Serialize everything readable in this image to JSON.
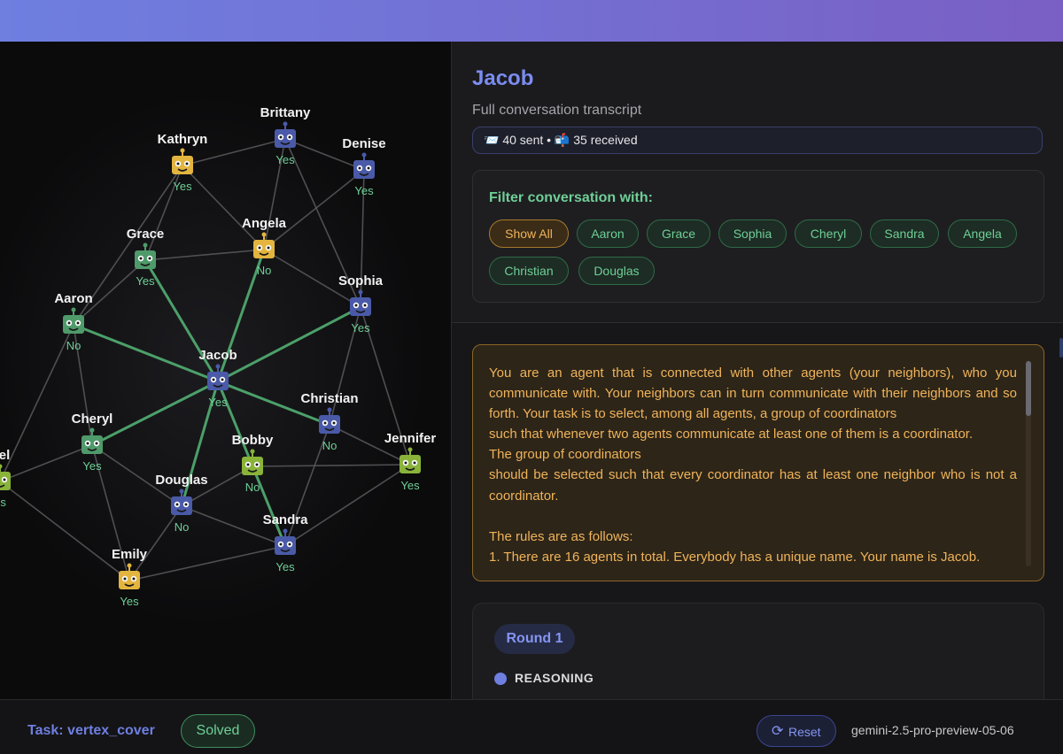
{
  "agent": {
    "name": "Jacob",
    "subtitle": "Full conversation transcript",
    "stats": "📨 40 sent • 📬 35 received"
  },
  "filter": {
    "title": "Filter conversation with:",
    "chips": [
      "Show All",
      "Aaron",
      "Grace",
      "Sophia",
      "Cheryl",
      "Sandra",
      "Angela",
      "Christian",
      "Douglas"
    ],
    "active": "Show All"
  },
  "prompt_text": "You are an agent that is connected with other agents (your neighbors), who you communicate with. Your neighbors can in turn communicate with their neighbors and so forth. Your task is to select, among all agents, a group of coordinators\nsuch that whenever two agents communicate at least one of them is a coordinator.\nThe group of coordinators\nshould be selected such that every coordinator has at least one neighbor who is not a coordinator.\n\nThe rules are as follows:\n1. There are 16 agents in total. Everybody has a unique name. Your name is Jacob.",
  "round": {
    "label": "Round 1",
    "section": "REASONING"
  },
  "footer": {
    "task": "Task: vertex_cover",
    "status": "Solved",
    "reset_label": "Reset",
    "model": "gemini-2.5-pro-preview-05-06"
  },
  "colors": {
    "blue": "#4a5aa8",
    "yellow": "#e3b53f",
    "green": "#4f9a6a",
    "lime": "#8ab33a",
    "edge": "#5a5a5e",
    "highlight": "#4fa86e"
  },
  "graph": {
    "nodes": [
      {
        "id": "Brittany",
        "label": "Brittany",
        "answer": "Yes",
        "color": "blue"
      },
      {
        "id": "Kathryn",
        "label": "Kathryn",
        "answer": "Yes",
        "color": "yellow"
      },
      {
        "id": "Denise",
        "label": "Denise",
        "answer": "Yes",
        "color": "blue"
      },
      {
        "id": "Grace",
        "label": "Grace",
        "answer": "Yes",
        "color": "green"
      },
      {
        "id": "Angela",
        "label": "Angela",
        "answer": "No",
        "color": "yellow"
      },
      {
        "id": "Sophia",
        "label": "Sophia",
        "answer": "Yes",
        "color": "blue"
      },
      {
        "id": "Aaron",
        "label": "Aaron",
        "answer": "No",
        "color": "green"
      },
      {
        "id": "Jacob",
        "label": "Jacob",
        "answer": "Yes",
        "color": "blue"
      },
      {
        "id": "Christian",
        "label": "Christian",
        "answer": "No",
        "color": "blue"
      },
      {
        "id": "Cheryl",
        "label": "Cheryl",
        "answer": "Yes",
        "color": "green"
      },
      {
        "id": "Bobby",
        "label": "Bobby",
        "answer": "No",
        "color": "lime"
      },
      {
        "id": "Jennifer",
        "label": "Jennifer",
        "answer": "Yes",
        "color": "lime"
      },
      {
        "id": "Gabriel",
        "label": "riel",
        "answer": "es",
        "color": "lime"
      },
      {
        "id": "Douglas",
        "label": "Douglas",
        "answer": "No",
        "color": "blue"
      },
      {
        "id": "Sandra",
        "label": "Sandra",
        "answer": "Yes",
        "color": "blue"
      },
      {
        "id": "Emily",
        "label": "Emily",
        "answer": "Yes",
        "color": "yellow"
      }
    ],
    "edges": [
      [
        "Jacob",
        "Aaron",
        true
      ],
      [
        "Jacob",
        "Grace",
        true
      ],
      [
        "Jacob",
        "Angela",
        true
      ],
      [
        "Jacob",
        "Sophia",
        true
      ],
      [
        "Jacob",
        "Christian",
        true
      ],
      [
        "Jacob",
        "Cheryl",
        true
      ],
      [
        "Jacob",
        "Douglas",
        true
      ],
      [
        "Jacob",
        "Sandra",
        true
      ],
      [
        "Kathryn",
        "Brittany",
        false
      ],
      [
        "Kathryn",
        "Grace",
        false
      ],
      [
        "Kathryn",
        "Angela",
        false
      ],
      [
        "Kathryn",
        "Aaron",
        false
      ],
      [
        "Brittany",
        "Denise",
        false
      ],
      [
        "Brittany",
        "Angela",
        false
      ],
      [
        "Brittany",
        "Sophia",
        false
      ],
      [
        "Denise",
        "Angela",
        false
      ],
      [
        "Denise",
        "Sophia",
        false
      ],
      [
        "Grace",
        "Angela",
        false
      ],
      [
        "Grace",
        "Aaron",
        false
      ],
      [
        "Angela",
        "Sophia",
        false
      ],
      [
        "Sophia",
        "Christian",
        false
      ],
      [
        "Sophia",
        "Jennifer",
        false
      ],
      [
        "Aaron",
        "Cheryl",
        false
      ],
      [
        "Aaron",
        "Gabriel",
        false
      ],
      [
        "Christian",
        "Jennifer",
        false
      ],
      [
        "Christian",
        "Sandra",
        false
      ],
      [
        "Cheryl",
        "Gabriel",
        false
      ],
      [
        "Cheryl",
        "Douglas",
        false
      ],
      [
        "Cheryl",
        "Emily",
        false
      ],
      [
        "Gabriel",
        "Emily",
        false
      ],
      [
        "Bobby",
        "Douglas",
        false
      ],
      [
        "Bobby",
        "Jennifer",
        false
      ],
      [
        "Douglas",
        "Sandra",
        false
      ],
      [
        "Douglas",
        "Emily",
        false
      ],
      [
        "Sandra",
        "Jennifer",
        false
      ],
      [
        "Sandra",
        "Emily",
        false
      ]
    ]
  }
}
